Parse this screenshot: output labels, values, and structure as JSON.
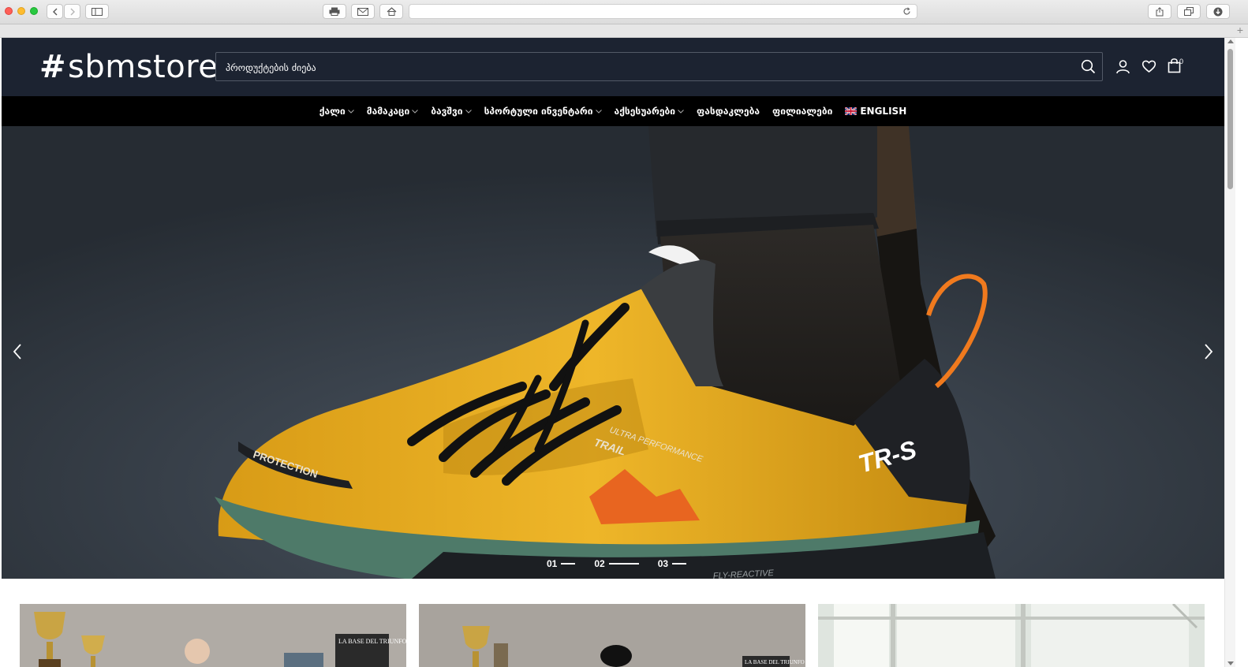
{
  "site": {
    "logo_hash": "#",
    "logo_text": "sbmstore",
    "search_placeholder": "პროდუქტების ძიება",
    "cart_count": "0"
  },
  "nav": {
    "items": [
      {
        "label": "ქალი",
        "dropdown": true
      },
      {
        "label": "მამაკაცი",
        "dropdown": true
      },
      {
        "label": "ბავშვი",
        "dropdown": true
      },
      {
        "label": "სპორტული ინვენტარი",
        "dropdown": true
      },
      {
        "label": "აქსესუარები",
        "dropdown": true
      },
      {
        "label": "ფასდაკლება",
        "dropdown": false
      },
      {
        "label": "ფილიალები",
        "dropdown": false
      }
    ],
    "language": {
      "label": "ENGLISH",
      "flag": "uk-flag-icon"
    }
  },
  "hero": {
    "slides": [
      {
        "label": "01",
        "active": false
      },
      {
        "label": "02",
        "active": true
      },
      {
        "label": "03",
        "active": false
      }
    ],
    "shoe_texts": {
      "protection": "PROTECTION",
      "trail": "TRAIL",
      "ultra": "ULTRA PERFORMANCE",
      "model": "TR-S",
      "sole": "FLY-REACTIVE"
    }
  },
  "cards": {
    "card1_poster": "LA BASE DEL TRIUNFO. POR SISTEMA.",
    "card2_poster": "LA BASE DEL TRIUNFO"
  },
  "colors": {
    "header_bg": "#1c2331",
    "nav_bg": "#000000",
    "shoe_yellow": "#e6ac1e",
    "shoe_accent": "#f07a1e"
  }
}
